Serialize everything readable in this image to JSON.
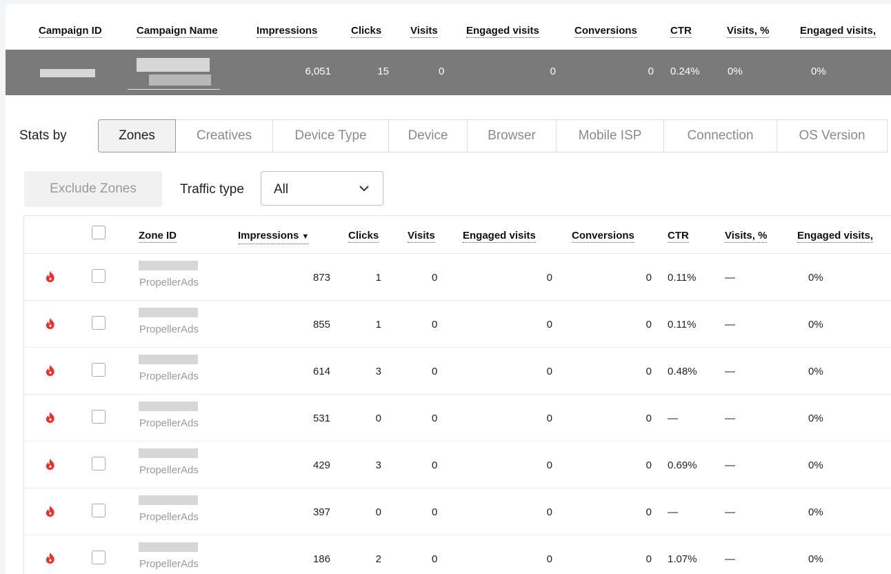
{
  "summary": {
    "headers": [
      "Campaign ID",
      "Campaign Name",
      "Impressions",
      "Clicks",
      "Visits",
      "Engaged visits",
      "Conversions",
      "CTR",
      "Visits, %",
      "Engaged visits,"
    ],
    "row": {
      "impressions": "6,051",
      "clicks": "15",
      "visits": "0",
      "engaged_visits": "0",
      "conversions": "0",
      "ctr": "0.24%",
      "visits_pct": "0%",
      "engaged_visits_pct": "0%"
    }
  },
  "stats_by": {
    "label": "Stats by",
    "tabs": [
      "Zones",
      "Creatives",
      "Device Type",
      "Device",
      "Browser",
      "Mobile ISP",
      "Connection",
      "OS Version"
    ],
    "active": "Zones"
  },
  "controls": {
    "exclude_label": "Exclude Zones",
    "traffic_type_label": "Traffic type",
    "traffic_type_value": "All"
  },
  "zones": {
    "headers": {
      "zone_id": "Zone ID",
      "impressions": "Impressions",
      "clicks": "Clicks",
      "visits": "Visits",
      "engaged_visits": "Engaged visits",
      "conversions": "Conversions",
      "ctr": "CTR",
      "visits_pct": "Visits, %",
      "engaged_visits_pct": "Engaged visits,"
    },
    "sort_indicator": "▼",
    "rows": [
      {
        "source": "PropellerAds",
        "impressions": "873",
        "clicks": "1",
        "visits": "0",
        "engaged_visits": "0",
        "conversions": "0",
        "ctr": "0.11%",
        "visits_pct": "—",
        "engaged_visits_pct": "0%"
      },
      {
        "source": "PropellerAds",
        "impressions": "855",
        "clicks": "1",
        "visits": "0",
        "engaged_visits": "0",
        "conversions": "0",
        "ctr": "0.11%",
        "visits_pct": "—",
        "engaged_visits_pct": "0%"
      },
      {
        "source": "PropellerAds",
        "impressions": "614",
        "clicks": "3",
        "visits": "0",
        "engaged_visits": "0",
        "conversions": "0",
        "ctr": "0.48%",
        "visits_pct": "—",
        "engaged_visits_pct": "0%"
      },
      {
        "source": "PropellerAds",
        "impressions": "531",
        "clicks": "0",
        "visits": "0",
        "engaged_visits": "0",
        "conversions": "0",
        "ctr": "—",
        "visits_pct": "—",
        "engaged_visits_pct": "0%"
      },
      {
        "source": "PropellerAds",
        "impressions": "429",
        "clicks": "3",
        "visits": "0",
        "engaged_visits": "0",
        "conversions": "0",
        "ctr": "0.69%",
        "visits_pct": "—",
        "engaged_visits_pct": "0%"
      },
      {
        "source": "PropellerAds",
        "impressions": "397",
        "clicks": "0",
        "visits": "0",
        "engaged_visits": "0",
        "conversions": "0",
        "ctr": "—",
        "visits_pct": "—",
        "engaged_visits_pct": "0%"
      },
      {
        "source": "PropellerAds",
        "impressions": "186",
        "clicks": "2",
        "visits": "0",
        "engaged_visits": "0",
        "conversions": "0",
        "ctr": "1.07%",
        "visits_pct": "—",
        "engaged_visits_pct": "0%"
      }
    ]
  },
  "colors": {
    "summary_row_bg": "#7a7a7a",
    "fire_icon": "#e8332a",
    "muted_text": "#9a9a9a"
  },
  "icons": [
    "fire-icon",
    "chevron-down-icon",
    "sort-desc-icon"
  ]
}
